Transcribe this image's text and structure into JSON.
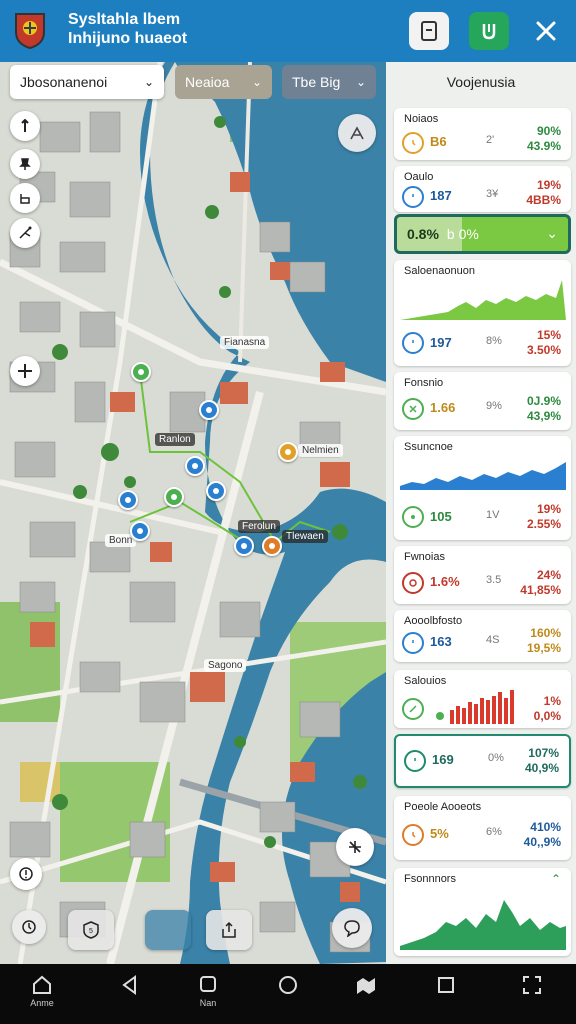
{
  "header": {
    "title_line1": "Sysltahla lbem",
    "title_line2": "Inhijuno huaeot"
  },
  "map": {
    "dropdowns": [
      {
        "label": "Jbosonanenoi"
      },
      {
        "label": "Neaioa"
      },
      {
        "label": "Tbe Big"
      }
    ],
    "labels": [
      {
        "text": "Fianasna"
      },
      {
        "text": "Ranlon"
      },
      {
        "text": "Nelmien"
      },
      {
        "text": "Ferolun"
      },
      {
        "text": "Tlewaen"
      },
      {
        "text": "Bonn"
      },
      {
        "text": "Sagono"
      }
    ]
  },
  "panel": {
    "title": "Voojenusia",
    "highlight": {
      "a": "0.8%",
      "b": "b 0%"
    },
    "cards": [
      {
        "title": "Noiaos",
        "v1": "B6",
        "v2": "2'",
        "v3a": "90%",
        "v3b": "43.9%"
      },
      {
        "title": "Oaulo",
        "v1": "187",
        "v2": "3¥",
        "v3a": "19%",
        "v3b": "4BB%"
      },
      {
        "title": "Saloenaonuon",
        "v1": "197",
        "v2": "8%",
        "v3a": "15%",
        "v3b": "3.50%"
      },
      {
        "title": "Fonsnio",
        "v1": "1.66",
        "v2": "9%",
        "v3a": "0J.9%",
        "v3b": "43,9%"
      },
      {
        "title": "Ssuncnoe",
        "v1": "105",
        "v2": "1V",
        "v3a": "19%",
        "v3b": "2.55%"
      },
      {
        "title": "Fwnoias",
        "v1": "1.6%",
        "v2": "3.5",
        "v3a": "24%",
        "v3b": "41,85%"
      },
      {
        "title": "Aooolbfosto",
        "v1": "163",
        "v2": "4S",
        "v3a": "160%",
        "v3b": "19,5%"
      },
      {
        "title": "Salouios",
        "v1": "",
        "v2": "",
        "v3a": "1%",
        "v3b": "0,0%"
      },
      {
        "title": "",
        "v1": "169",
        "v2": "0%",
        "v3a": "107%",
        "v3b": "40,9%"
      },
      {
        "title": "Poeole Aooeots",
        "v1": "5%",
        "v2": "6%",
        "v3a": "410%",
        "v3b": "40,,9%"
      },
      {
        "title": "Fsonnnors",
        "v1": "",
        "v2": "",
        "v3a": "",
        "v3b": ""
      }
    ]
  },
  "navbar": {
    "home_label": "Anme",
    "nav_label": "Nan"
  },
  "colors": {
    "header_bg": "#1e7fc0",
    "water": "#3b82a8",
    "green_accent": "#6cc33a",
    "red_accent": "#d93a2b",
    "blue_accent": "#2a7fd0"
  }
}
